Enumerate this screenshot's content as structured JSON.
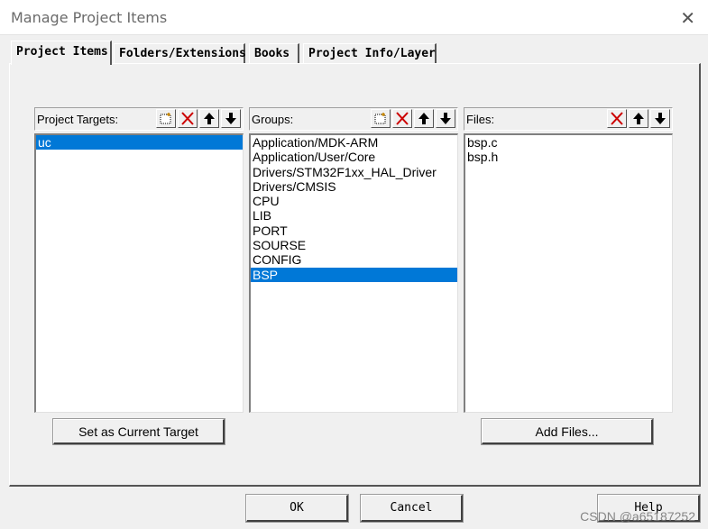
{
  "window": {
    "title": "Manage Project Items",
    "close_glyph": "✕"
  },
  "tabs": [
    {
      "label": "Project Items",
      "active": true
    },
    {
      "label": "Folders/Extensions",
      "active": false
    },
    {
      "label": "Books",
      "active": false
    },
    {
      "label": "Project Info/Layer",
      "active": false
    }
  ],
  "targets": {
    "label": "Project Targets:",
    "tools": [
      "new-icon",
      "delete-icon",
      "move-up-icon",
      "move-down-icon"
    ],
    "items": [
      "uc"
    ],
    "selected": "uc",
    "button": "Set as Current Target"
  },
  "groups": {
    "label": "Groups:",
    "tools": [
      "new-icon",
      "delete-icon",
      "move-up-icon",
      "move-down-icon"
    ],
    "items": [
      "Application/MDK-ARM",
      "Application/User/Core",
      "Drivers/STM32F1xx_HAL_Driver",
      "Drivers/CMSIS",
      "CPU",
      "LIB",
      "PORT",
      "SOURSE",
      "CONFIG",
      "BSP"
    ],
    "selected": "BSP"
  },
  "files": {
    "label": "Files:",
    "tools": [
      "delete-icon",
      "move-up-icon",
      "move-down-icon"
    ],
    "items": [
      "bsp.c",
      "bsp.h"
    ],
    "button": "Add Files..."
  },
  "footer": {
    "ok": "OK",
    "cancel": "Cancel",
    "help": "Help"
  },
  "watermark": "CSDN @a65187252",
  "colors": {
    "selection": "#0078d7",
    "delete": "#cc0000"
  }
}
